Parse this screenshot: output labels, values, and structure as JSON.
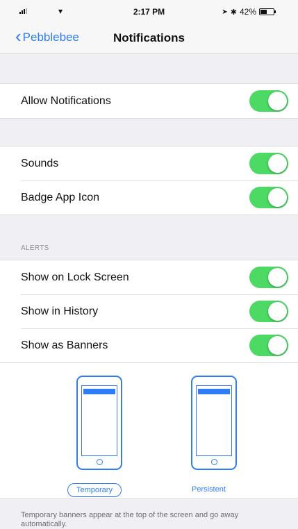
{
  "status_bar": {
    "time": "2:17 PM",
    "battery": "42%"
  },
  "nav": {
    "back_label": "Pebblebee",
    "title": "Notifications"
  },
  "section_allow": {
    "items": [
      {
        "label": "Allow Notifications",
        "on": true
      }
    ]
  },
  "section_sounds": {
    "items": [
      {
        "label": "Sounds",
        "on": true
      },
      {
        "label": "Badge App Icon",
        "on": true
      }
    ]
  },
  "alerts": {
    "header": "ALERTS",
    "items": [
      {
        "label": "Show on Lock Screen",
        "on": true
      },
      {
        "label": "Show in History",
        "on": true
      },
      {
        "label": "Show as Banners",
        "on": true
      }
    ]
  },
  "banner_style": {
    "options": [
      "Temporary",
      "Persistent"
    ],
    "selected": "Temporary"
  },
  "footer": {
    "note": "Temporary banners appear at the top of the screen and go away automatically."
  },
  "colors": {
    "accent": "#2f7cf6",
    "toggle_on": "#4cd964",
    "background": "#efeff4"
  }
}
